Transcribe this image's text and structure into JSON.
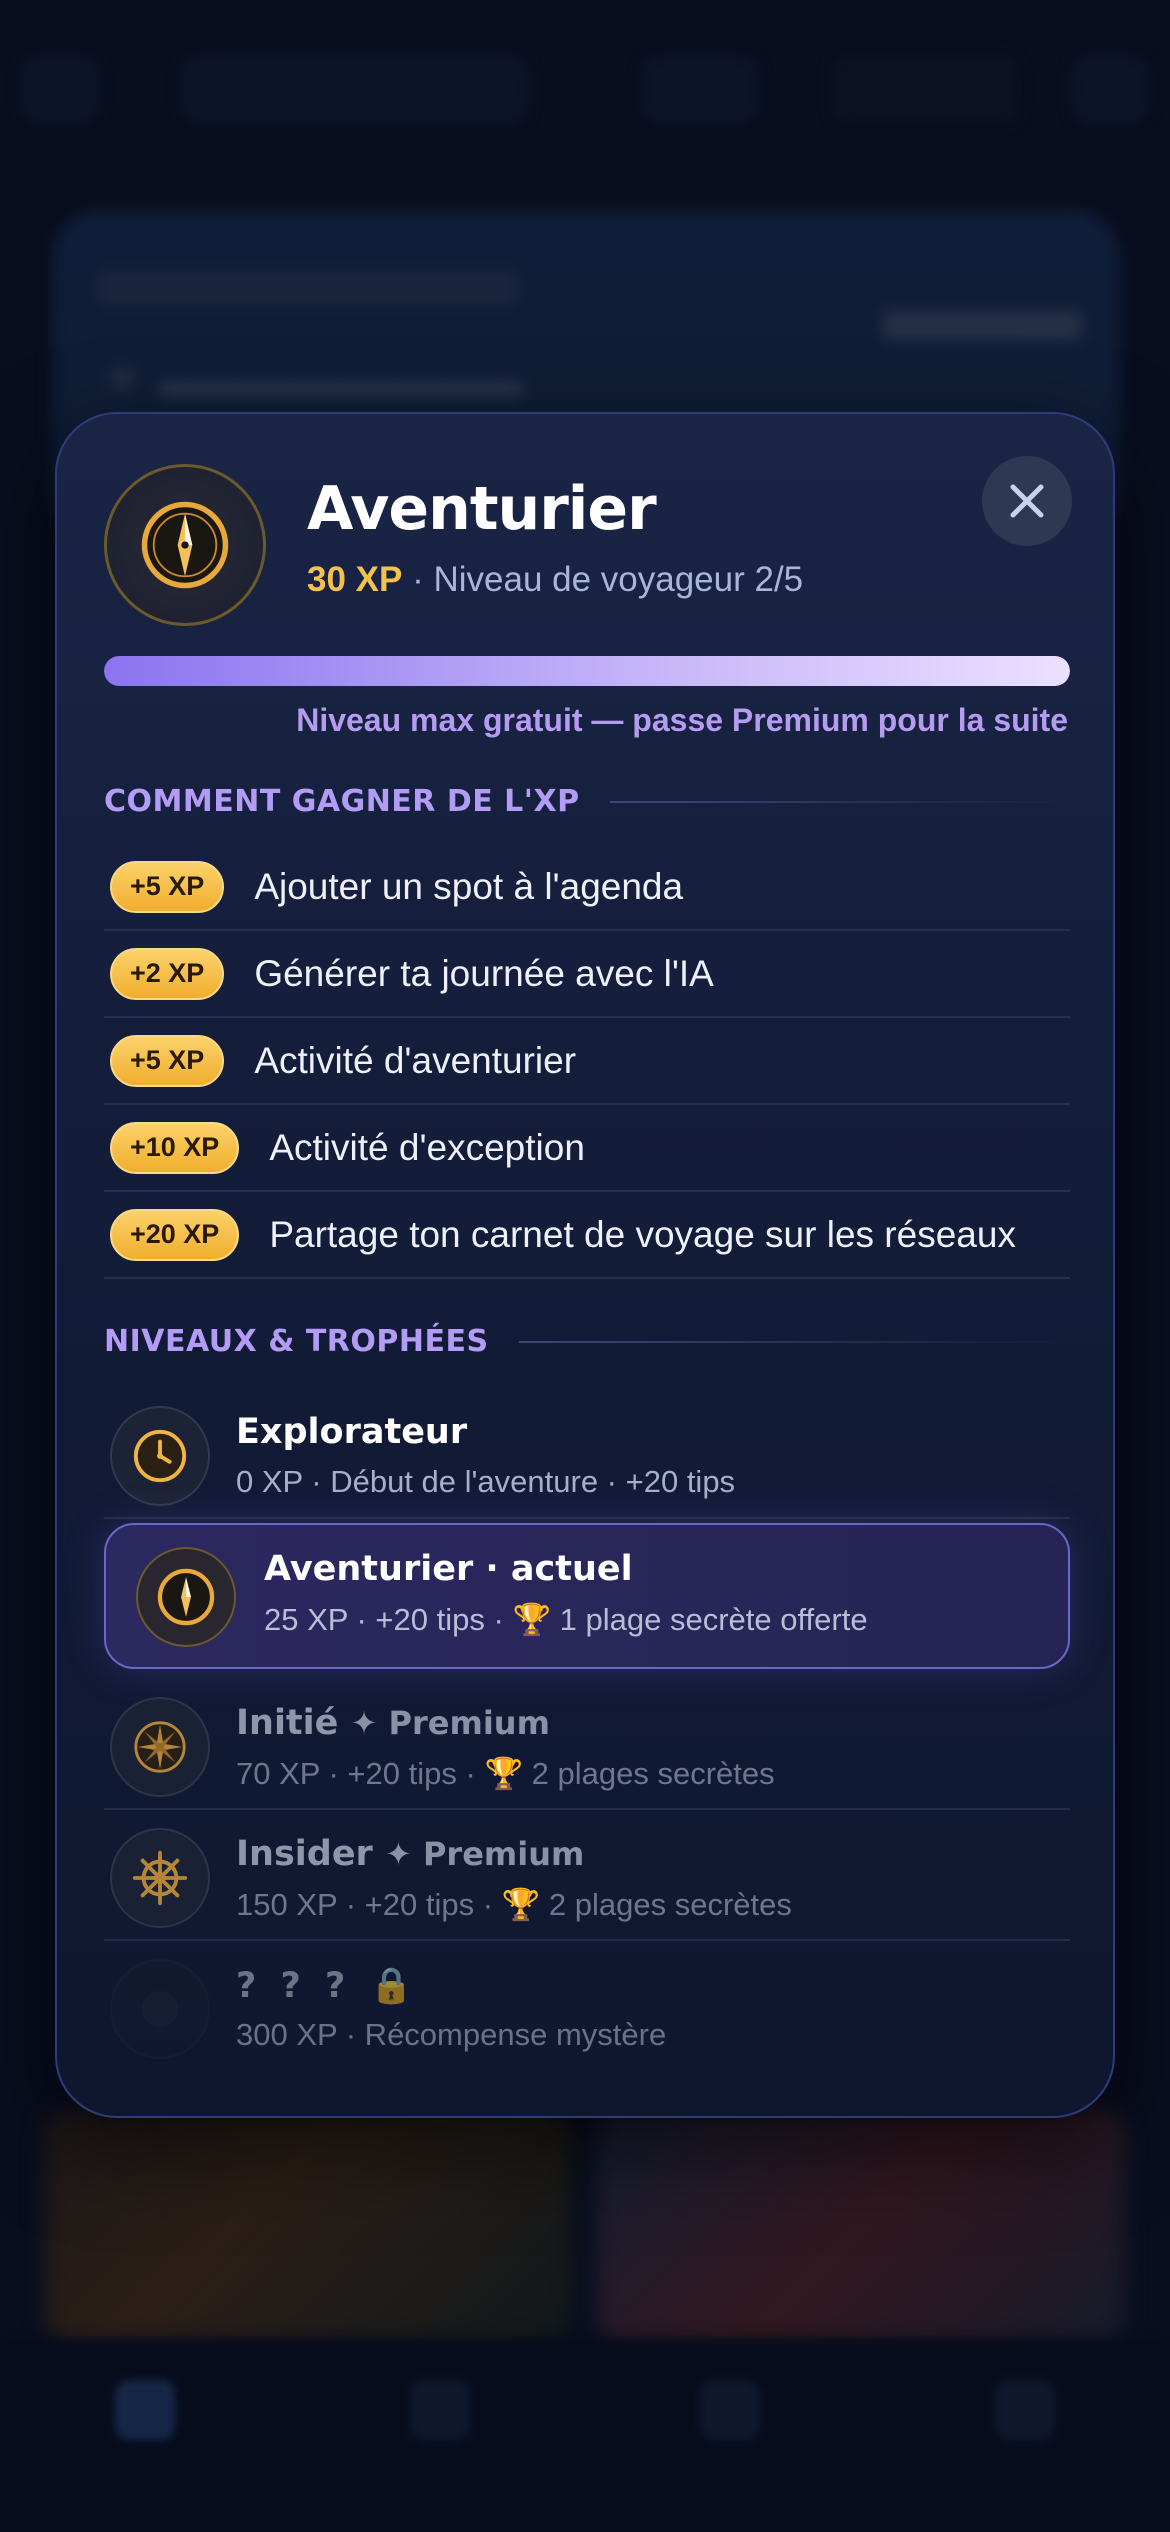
{
  "modal": {
    "title": "Aventurier",
    "xp_value": "30 XP",
    "level_text": " · Niveau de voyageur 2/5",
    "progress_fraction": 1.0,
    "progress_note": "Niveau max gratuit — passe Premium pour la suite",
    "close_icon": "close-icon",
    "hero_icon": "compass-icon"
  },
  "earn_section": {
    "title": "COMMENT GAGNER DE L'XP",
    "items": [
      {
        "xp": "+5 XP",
        "label": "Ajouter un spot à l'agenda"
      },
      {
        "xp": "+2 XP",
        "label": "Générer ta journée avec l'IA"
      },
      {
        "xp": "+5 XP",
        "label": "Activité d'aventurier"
      },
      {
        "xp": "+10 XP",
        "label": "Activité d'exception"
      },
      {
        "xp": "+20 XP",
        "label": "Partage ton carnet de voyage sur les réseaux"
      }
    ]
  },
  "levels_section": {
    "title": "NIVEAUX & TROPHÉES",
    "levels": [
      {
        "name": "Explorateur",
        "desc": "0 XP · Début de l'aventure · +20 tips",
        "icon": "clock-icon"
      },
      {
        "name": "Aventurier · actuel",
        "desc": "25 XP · +20 tips · ",
        "trophy": "🏆",
        "reward": " 1 plage secrète offerte",
        "icon": "compass-icon"
      },
      {
        "name": "Initié",
        "premium": "✦ Premium",
        "desc": "70 XP · +20 tips · ",
        "trophy": "🏆",
        "reward": " 2 plages secrètes",
        "icon": "compass-rose-icon"
      },
      {
        "name": "Insider",
        "premium": "✦ Premium",
        "desc": "150 XP · +20 tips · ",
        "trophy": "🏆",
        "reward": " 2 plages secrètes",
        "icon": "ship-wheel-icon"
      },
      {
        "name": "? ? ?",
        "lock": "🔒",
        "desc": "300 XP · Récompense mystère",
        "icon": "mystery-icon"
      }
    ]
  },
  "colors": {
    "accent_purple": "#b39cf5",
    "xp_gold": "#f3c14e",
    "modal_bg": "#131c38"
  }
}
